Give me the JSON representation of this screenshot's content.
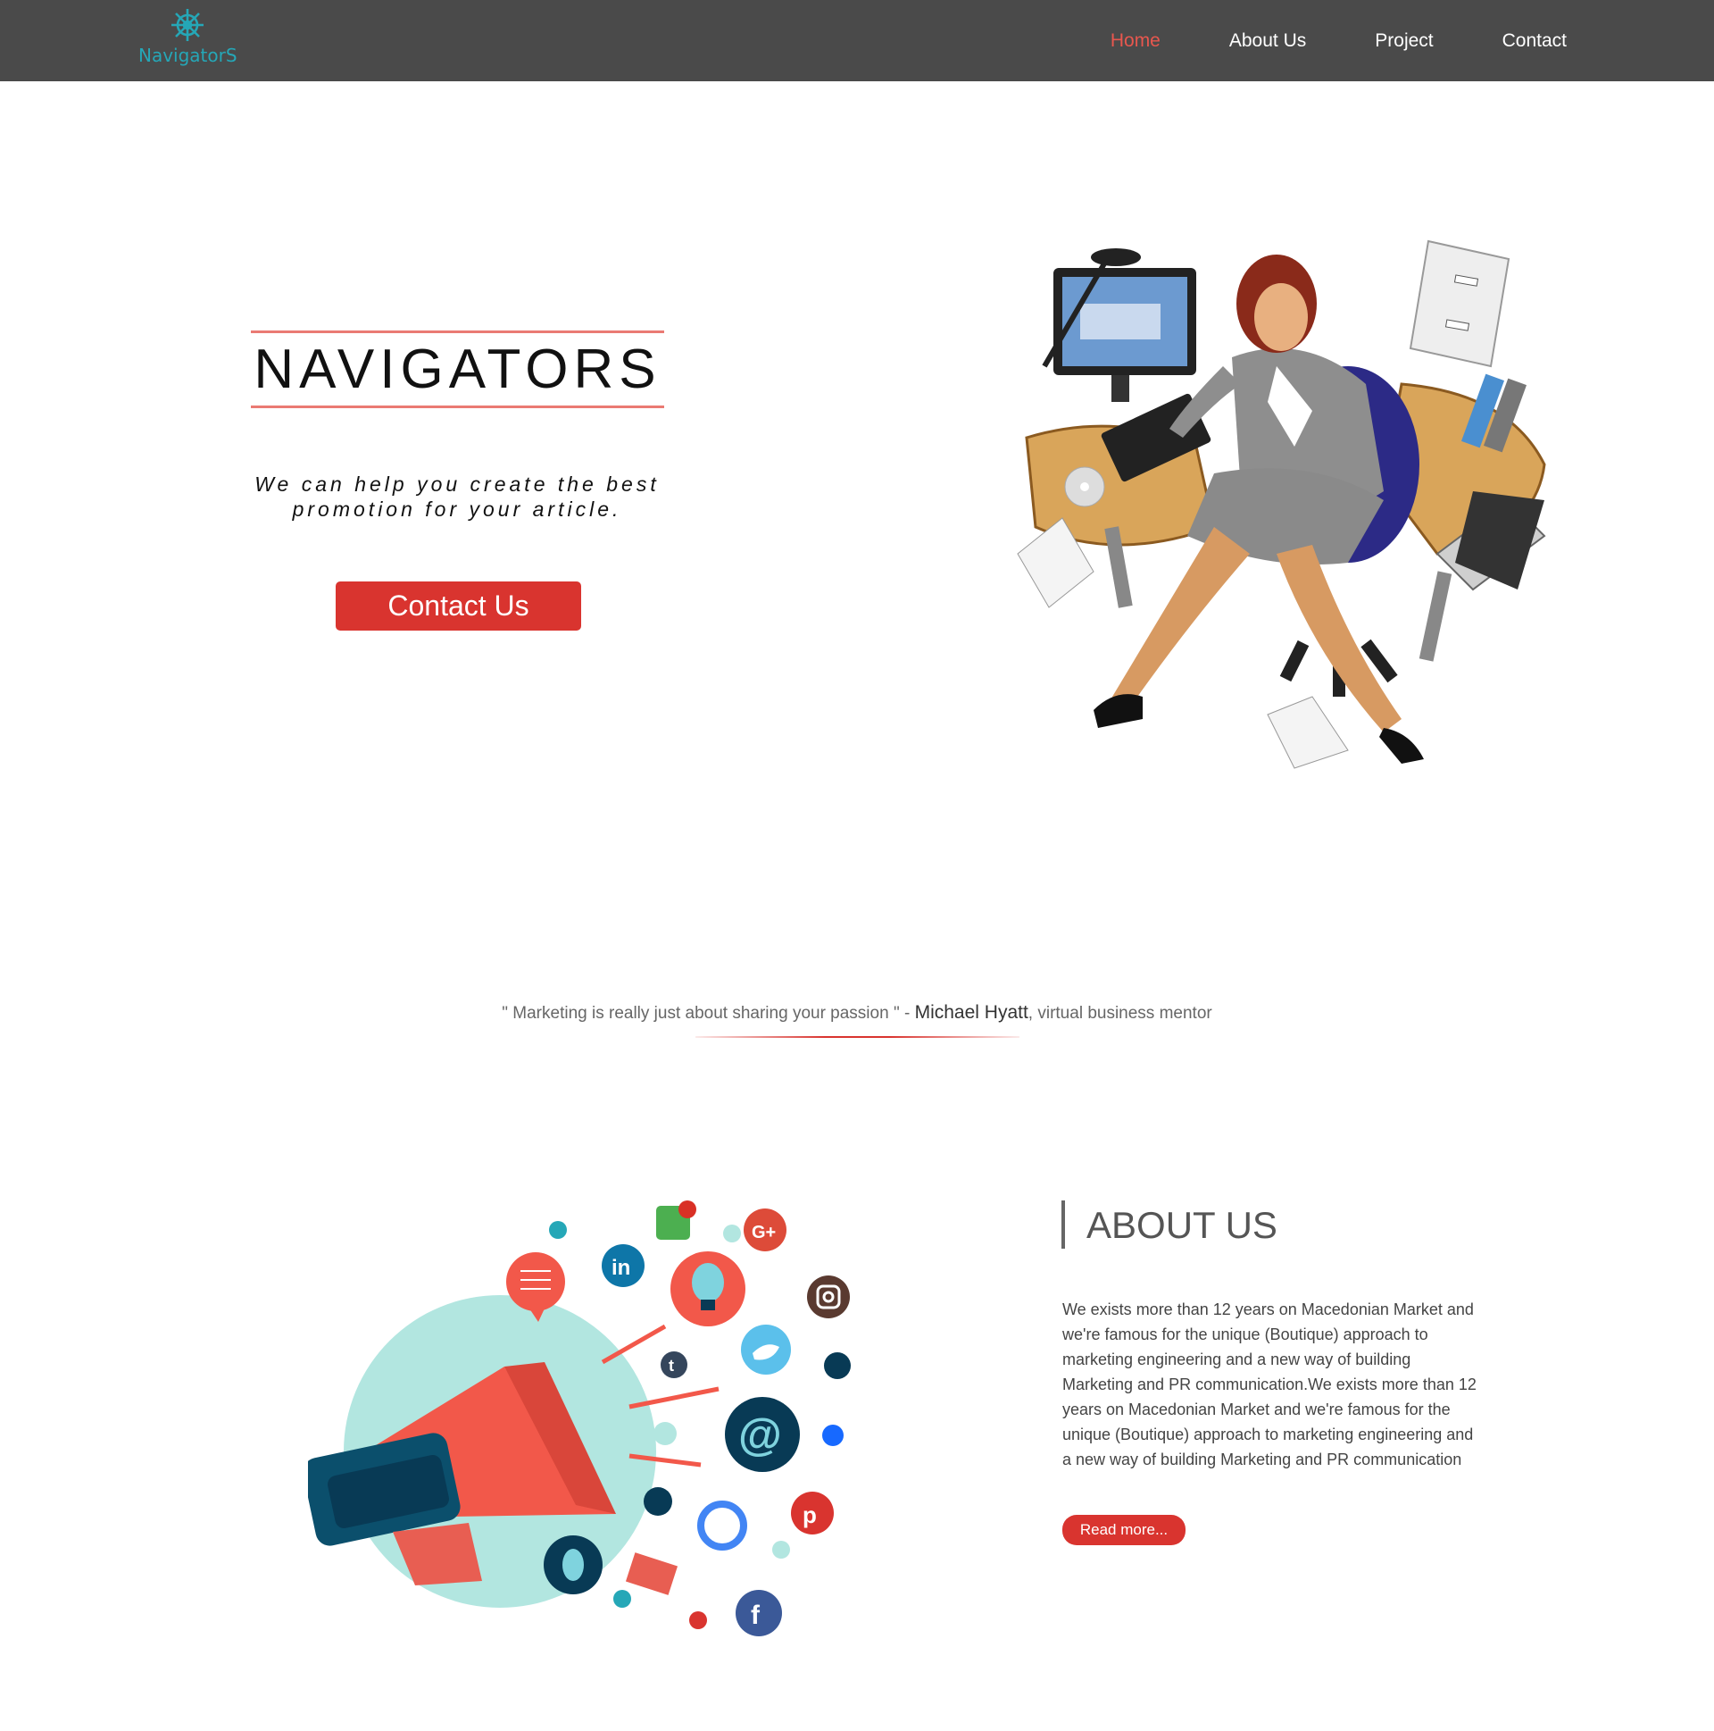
{
  "brand": {
    "logo_text": "NavigatorS",
    "accent": "#d9342f",
    "nav_bg": "#4a4a4a",
    "logo_color": "#25a7b7"
  },
  "nav": {
    "items": [
      {
        "label": "Home",
        "active": true
      },
      {
        "label": "About Us",
        "active": false
      },
      {
        "label": "Project",
        "active": false
      },
      {
        "label": "Contact",
        "active": false
      }
    ]
  },
  "hero": {
    "title": "NAVIGATORS",
    "subtitle_line1": "We can help you create the best",
    "subtitle_line2": "promotion for your article.",
    "button_label": "Contact Us",
    "illustration": "businesswoman-desk-illustration"
  },
  "quote": {
    "text": "\" Marketing is really just about sharing your passion \" - ",
    "author": "Michael Hyatt",
    "role": ", virtual business mentor"
  },
  "about": {
    "title": "ABOUT US",
    "text": "We exists more than 12 years on Macedonian Market and we're famous for the unique (Boutique) approach to marketing engineering and a new way of building Marketing and PR communication.We exists more than 12 years on Macedonian Market and we're famous for the unique (Boutique) approach to marketing engineering and a new way of building Marketing and PR communication",
    "button_label": "Read more...",
    "illustration": "megaphone-social-media-illustration"
  }
}
